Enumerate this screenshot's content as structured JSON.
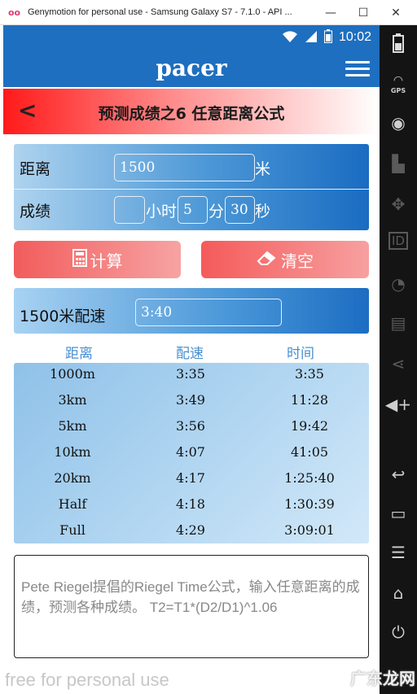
{
  "window": {
    "app_icon": "oo",
    "title": "Genymotion for personal use - Samsung Galaxy S7 - 7.1.0 - API ...",
    "buttons": {
      "minimize": "—",
      "maximize": "☐",
      "close": "✕"
    }
  },
  "statusbar": {
    "time": "10:02",
    "icons": [
      "wifi-icon",
      "signal-icon",
      "battery-icon"
    ]
  },
  "appbar": {
    "logo": "pacer",
    "menu_icon": "hamburger-menu-icon"
  },
  "page": {
    "back_icon": "<",
    "title": "预测成绩之6 任意距离公式"
  },
  "inputs": {
    "distance_label": "距离",
    "distance_value": "1500",
    "distance_unit": "米",
    "result_label": "成绩",
    "hours_value": "",
    "hours_unit": "小时",
    "minutes_value": "5",
    "minutes_unit": "分",
    "seconds_value": "30",
    "seconds_unit": "秒"
  },
  "buttons": {
    "calculate": "计算",
    "clear": "清空"
  },
  "pace": {
    "label": "1500米配速",
    "value": "3:40"
  },
  "table": {
    "headers": [
      "距离",
      "配速",
      "时间"
    ],
    "rows": [
      [
        "1000m",
        "3:35",
        "3:35"
      ],
      [
        "3km",
        "3:49",
        "11:28"
      ],
      [
        "5km",
        "3:56",
        "19:42"
      ],
      [
        "10km",
        "4:07",
        "41:05"
      ],
      [
        "20km",
        "4:17",
        "1:25:40"
      ],
      [
        "Half",
        "4:18",
        "1:30:39"
      ],
      [
        "Full",
        "4:29",
        "3:09:01"
      ]
    ]
  },
  "description": "Pete Riegel提倡的Riegel Time公式，输入任意距离的成绩，预测各种成绩。 T2=T1*(D2/D1)^1.06",
  "watermark": "free for personal use",
  "site_watermark": "广东龙网",
  "sidepanel": {
    "gps_label": "GPS",
    "id_label": "ID"
  },
  "colors": {
    "primary": "#1e6fc0",
    "accent_red": "#f25c5c",
    "table_bg": "#b3d7f2"
  }
}
